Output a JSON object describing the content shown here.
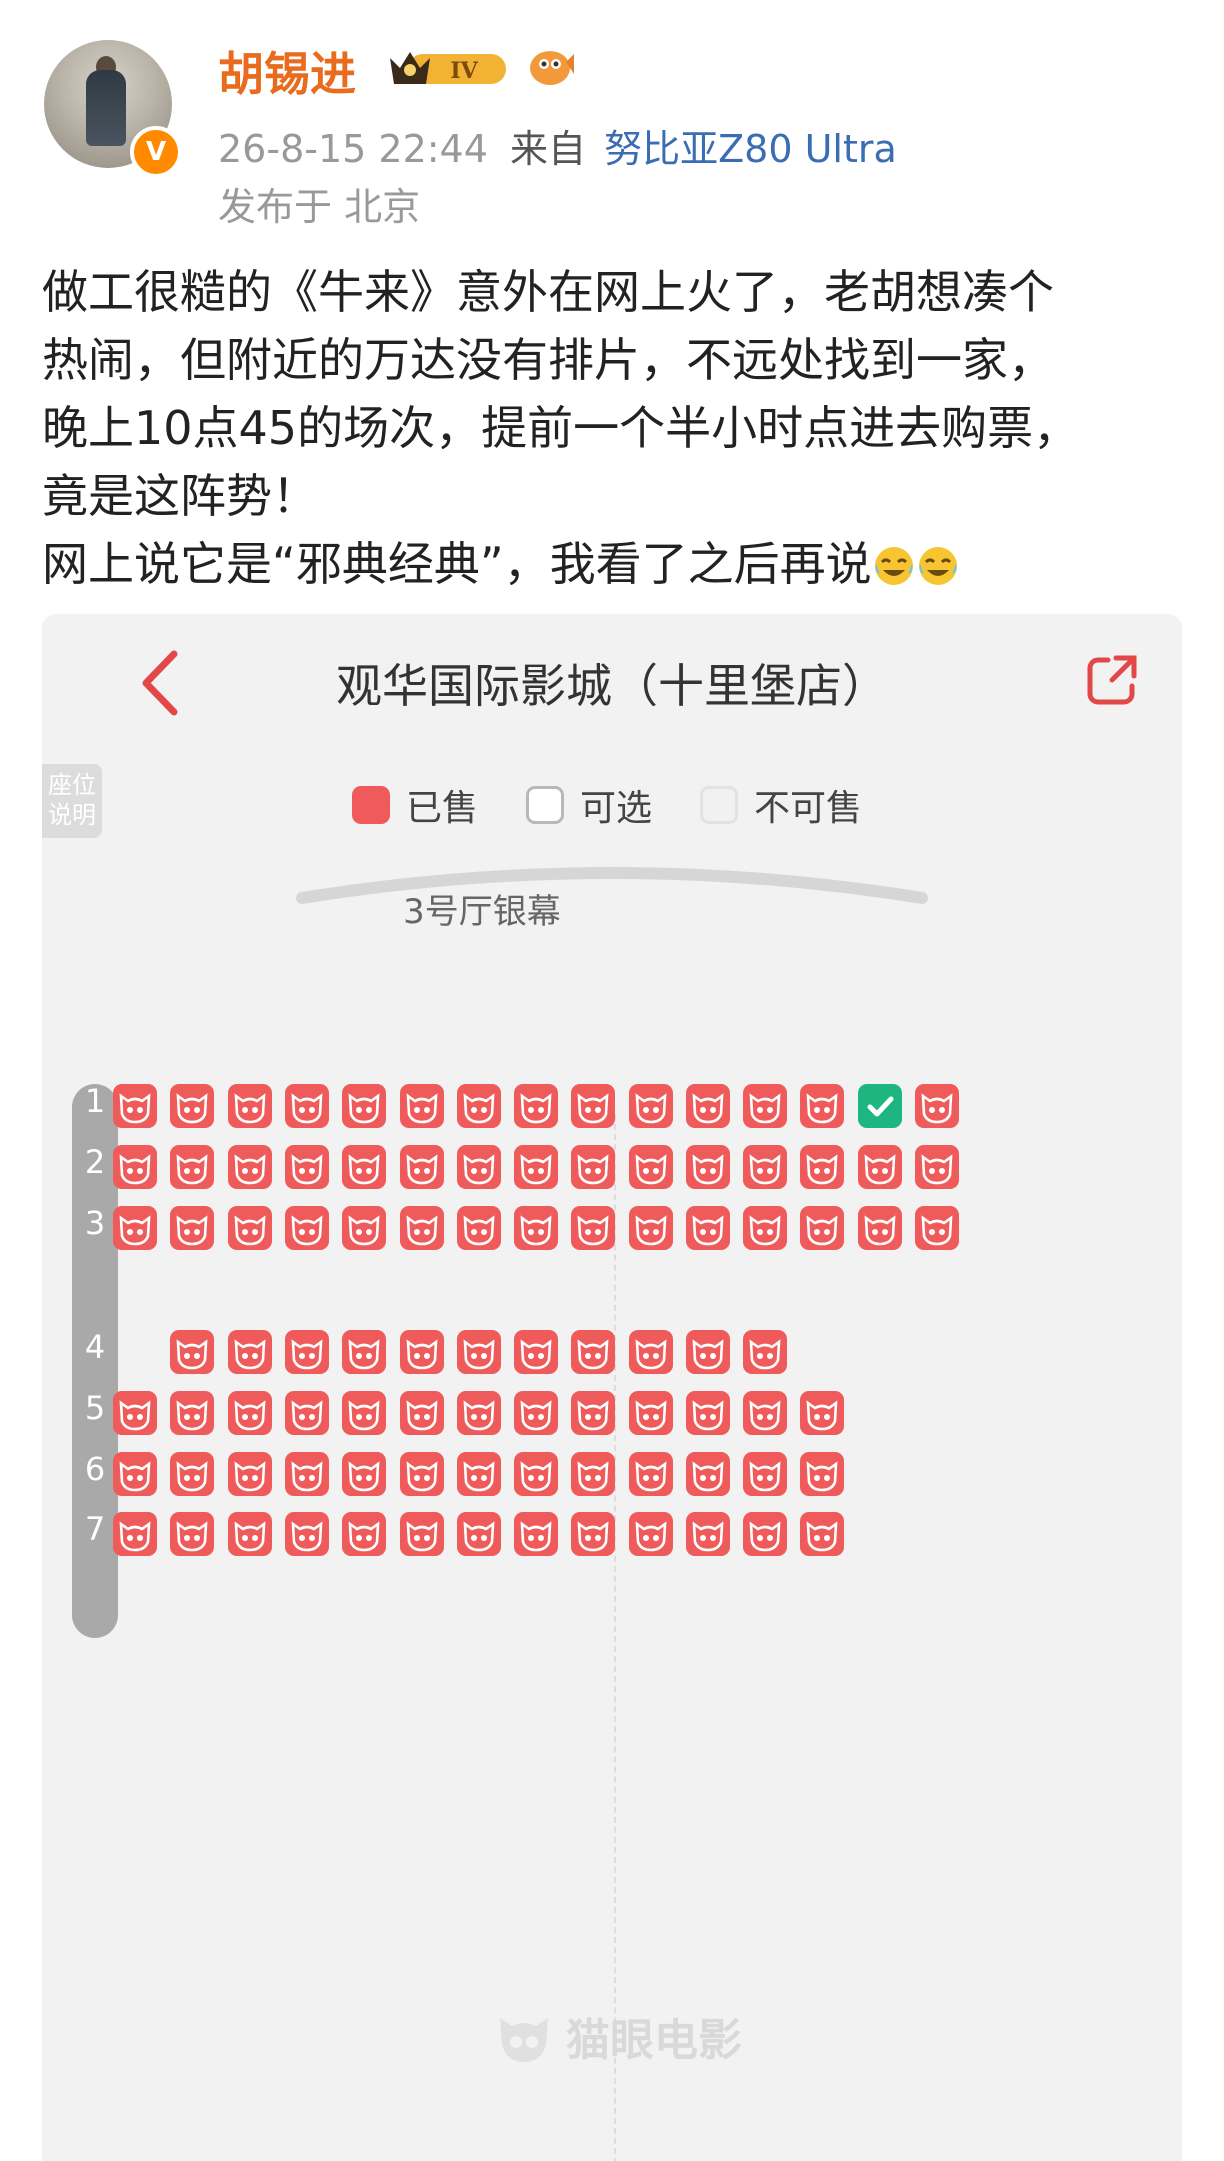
{
  "post": {
    "username": "胡锡进",
    "level_badge": "IV",
    "timestamp": "26-8-15 22:44",
    "source_prefix": "来自",
    "device": "努比亚Z80 Ultra",
    "location": "发布于 北京",
    "text_lines": [
      "做工很糙的《牛来》意外在网上火了，老胡想凑个",
      "热闹，但附近的万达没有排片，不远处找到一家，",
      "晚上10点45的场次，提前一个半小时点进去购票，",
      "竟是这阵势！",
      "网上说它是“邪典经典”，我看了之后再说"
    ],
    "emoji": "crying-laughing-icon"
  },
  "screenshot": {
    "title": "观华国际影城（十里堡店）",
    "seat_tab": "座位说明",
    "legend": {
      "sold": "已售",
      "available": "可选",
      "unavailable": "不可售"
    },
    "screen_label": "3号厅银幕",
    "watermark": "猫眼电影",
    "colors": {
      "sold": "#ef5a5a",
      "selected": "#1db580"
    },
    "rows": [
      {
        "label": "1",
        "seats": 15,
        "offset": 0,
        "selected_index": 13
      },
      {
        "label": "2",
        "seats": 15,
        "offset": 0
      },
      {
        "label": "3",
        "seats": 15,
        "offset": 0
      },
      {
        "label": "4",
        "seats": 11,
        "offset": 1
      },
      {
        "label": "5",
        "seats": 13,
        "offset": 0
      },
      {
        "label": "6",
        "seats": 13,
        "offset": 0
      },
      {
        "label": "7",
        "seats": 13,
        "offset": 0
      }
    ]
  }
}
